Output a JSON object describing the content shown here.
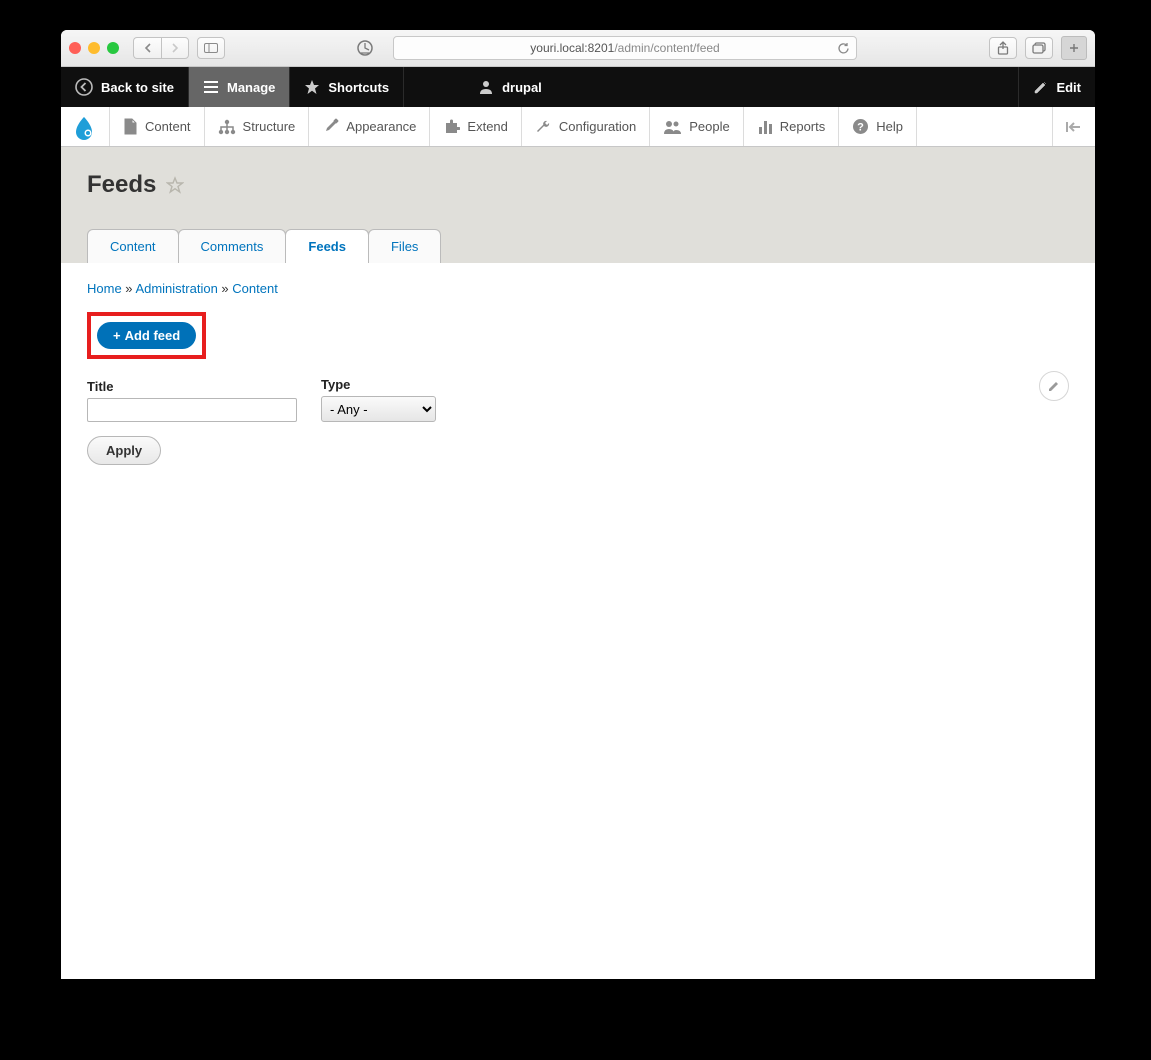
{
  "browser": {
    "url_host": "youri.local:8201",
    "url_path": "/admin/content/feed"
  },
  "toolbar": {
    "back_to_site": "Back to site",
    "manage": "Manage",
    "shortcuts": "Shortcuts",
    "user": "drupal",
    "edit": "Edit"
  },
  "adminmenu": {
    "content": "Content",
    "structure": "Structure",
    "appearance": "Appearance",
    "extend": "Extend",
    "configuration": "Configuration",
    "people": "People",
    "reports": "Reports",
    "help": "Help"
  },
  "page": {
    "title": "Feeds",
    "tabs": {
      "content": "Content",
      "comments": "Comments",
      "feeds": "Feeds",
      "files": "Files"
    },
    "breadcrumb": {
      "home": "Home",
      "admin": "Administration",
      "content": "Content",
      "sep": " » "
    },
    "add_feed": "Add feed",
    "filters": {
      "title_label": "Title",
      "title_value": "",
      "type_label": "Type",
      "type_value": "- Any -",
      "apply": "Apply"
    }
  }
}
